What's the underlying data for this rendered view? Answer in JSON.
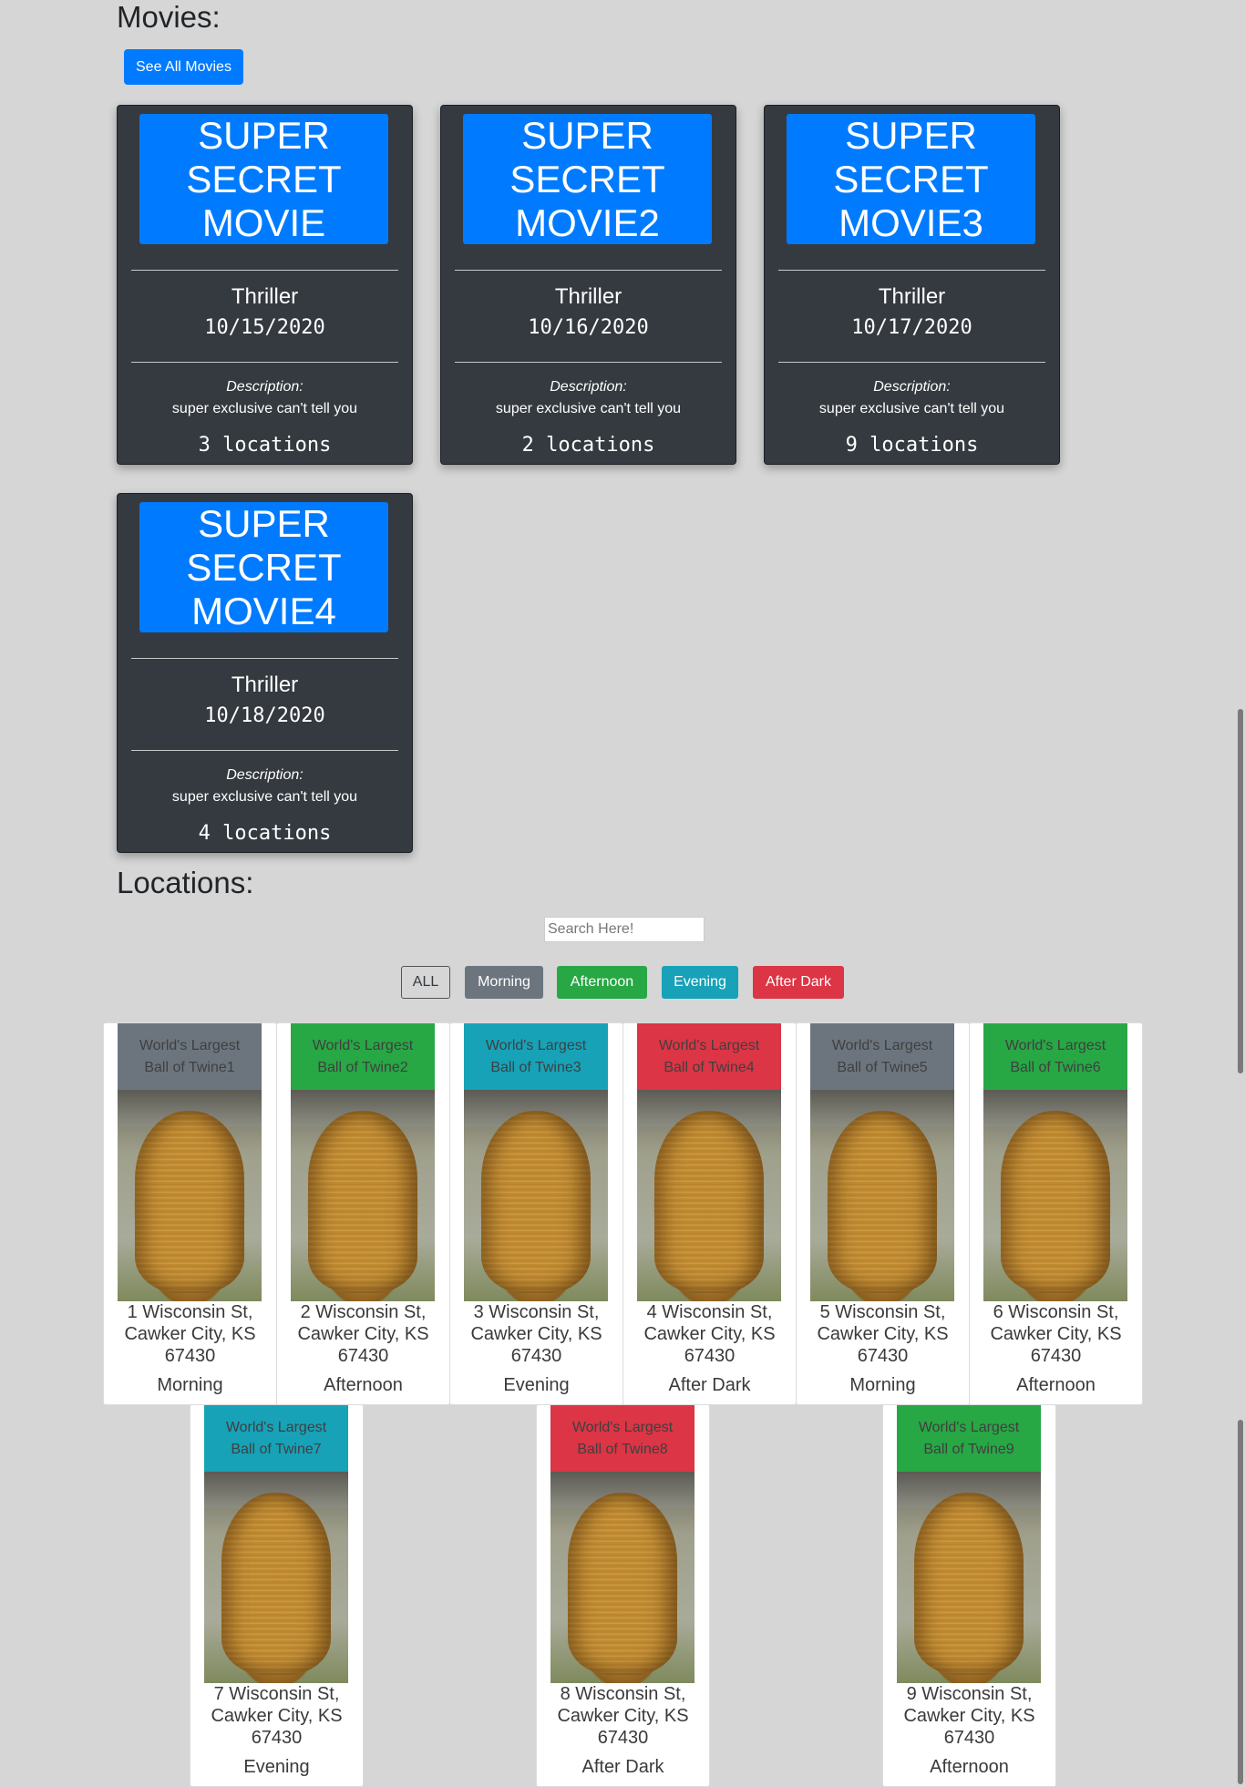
{
  "movies": {
    "title": "Movies:",
    "see_all_label": "See All Movies",
    "items": [
      {
        "poster": "SUPER SECRET MOVIE",
        "genre": "Thriller",
        "date": "10/15/2020",
        "desc_label": "Description:",
        "desc": "super exclusive can't tell you",
        "locations": "3 locations"
      },
      {
        "poster": "SUPER SECRET MOVIE2",
        "genre": "Thriller",
        "date": "10/16/2020",
        "desc_label": "Description:",
        "desc": "super exclusive can't tell you",
        "locations": "2 locations"
      },
      {
        "poster": "SUPER SECRET MOVIE3",
        "genre": "Thriller",
        "date": "10/17/2020",
        "desc_label": "Description:",
        "desc": "super exclusive can't tell you",
        "locations": "9 locations"
      },
      {
        "poster": "SUPER SECRET MOVIE4",
        "genre": "Thriller",
        "date": "10/18/2020",
        "desc_label": "Description:",
        "desc": "super exclusive can't tell you",
        "locations": "4 locations"
      }
    ]
  },
  "locations": {
    "title": "Locations:",
    "search_placeholder": "Search Here!",
    "filters": {
      "all": "ALL",
      "morning": "Morning",
      "afternoon": "Afternoon",
      "evening": "Evening",
      "after_dark": "After Dark"
    },
    "items": [
      {
        "name": "World's Largest Ball of Twine1",
        "address": "1 Wisconsin St, Cawker City, KS 67430",
        "time": "Morning"
      },
      {
        "name": "World's Largest Ball of Twine2",
        "address": "2 Wisconsin St, Cawker City, KS 67430",
        "time": "Afternoon"
      },
      {
        "name": "World's Largest Ball of Twine3",
        "address": "3 Wisconsin St, Cawker City, KS 67430",
        "time": "Evening"
      },
      {
        "name": "World's Largest Ball of Twine4",
        "address": "4 Wisconsin St, Cawker City, KS 67430",
        "time": "After Dark"
      },
      {
        "name": "World's Largest Ball of Twine5",
        "address": "5 Wisconsin St, Cawker City, KS 67430",
        "time": "Morning"
      },
      {
        "name": "World's Largest Ball of Twine6",
        "address": "6 Wisconsin St, Cawker City, KS 67430",
        "time": "Afternoon"
      },
      {
        "name": "World's Largest Ball of Twine7",
        "address": "7 Wisconsin St, Cawker City, KS 67430",
        "time": "Evening"
      },
      {
        "name": "World's Largest Ball of Twine8",
        "address": "8 Wisconsin St, Cawker City, KS 67430",
        "time": "After Dark"
      },
      {
        "name": "World's Largest Ball of Twine9",
        "address": "9 Wisconsin St, Cawker City, KS 67430",
        "time": "Afternoon"
      }
    ]
  },
  "colors": {
    "primary": "#007bff",
    "morning": "#6c757d",
    "afternoon": "#28a745",
    "evening": "#17a2b8",
    "after_dark": "#dc3545",
    "card_dark": "#343a40"
  }
}
